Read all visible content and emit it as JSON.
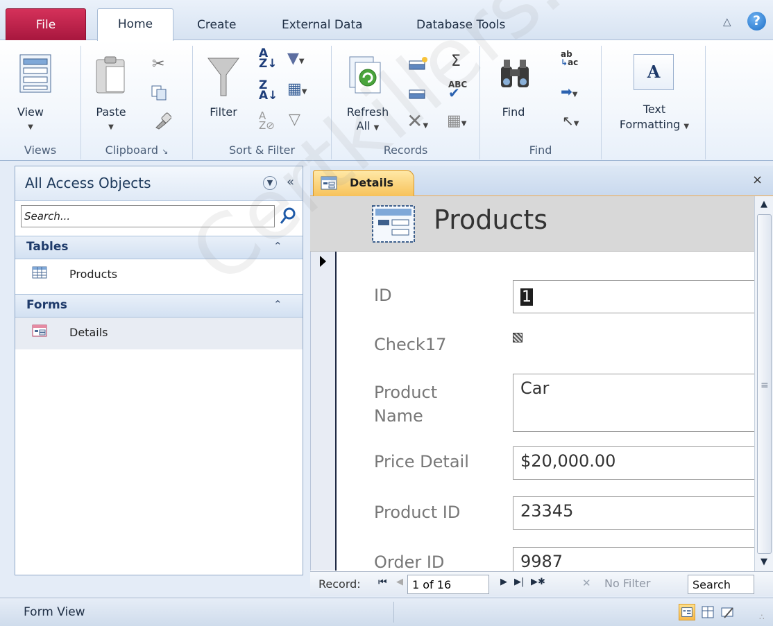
{
  "ribbon_tabs": {
    "file": "File",
    "home": "Home",
    "create": "Create",
    "external": "External Data",
    "dbtools": "Database Tools",
    "help": "?"
  },
  "ribbon": {
    "views": {
      "label": "Views",
      "view": "View"
    },
    "clipboard": {
      "label": "Clipboard",
      "paste": "Paste"
    },
    "sort_filter": {
      "label": "Sort & Filter",
      "filter": "Filter"
    },
    "records": {
      "label": "Records",
      "refresh_line1": "Refresh",
      "refresh_line2": "All",
      "sigma": "Σ"
    },
    "find": {
      "label": "Find",
      "find": "Find",
      "replace_icon_text": "ab→ac"
    },
    "text": {
      "text_line1": "Text",
      "text_line2": "Formatting",
      "icon_letter": "A"
    }
  },
  "nav": {
    "title": "All Access Objects",
    "search_placeholder": "Search...",
    "groups": [
      {
        "label": "Tables",
        "items": [
          {
            "label": "Products"
          }
        ]
      },
      {
        "label": "Forms",
        "items": [
          {
            "label": "Details"
          }
        ]
      }
    ]
  },
  "doc": {
    "tab_label": "Details",
    "close": "×",
    "form_title": "Products",
    "fields": {
      "id_label": "ID",
      "id_value": "1",
      "check_label": "Check17",
      "pname_label_1": "Product",
      "pname_label_2": "Name",
      "pname_value": "Car",
      "price_label": "Price Detail",
      "price_value": "$20,000.00",
      "pid_label": "Product ID",
      "pid_value": "23345",
      "oid_label": "Order ID",
      "oid_value": "9987"
    },
    "record_nav": {
      "label": "Record:",
      "current": "1 of 16",
      "filter": "No Filter",
      "search": "Search"
    }
  },
  "status": {
    "text": "Form View"
  },
  "watermark": "Certkillers.net",
  "colors": {
    "file_tab": "#c0274f",
    "doc_tab": "#f7c25a",
    "accent": "#1e6fc6"
  }
}
